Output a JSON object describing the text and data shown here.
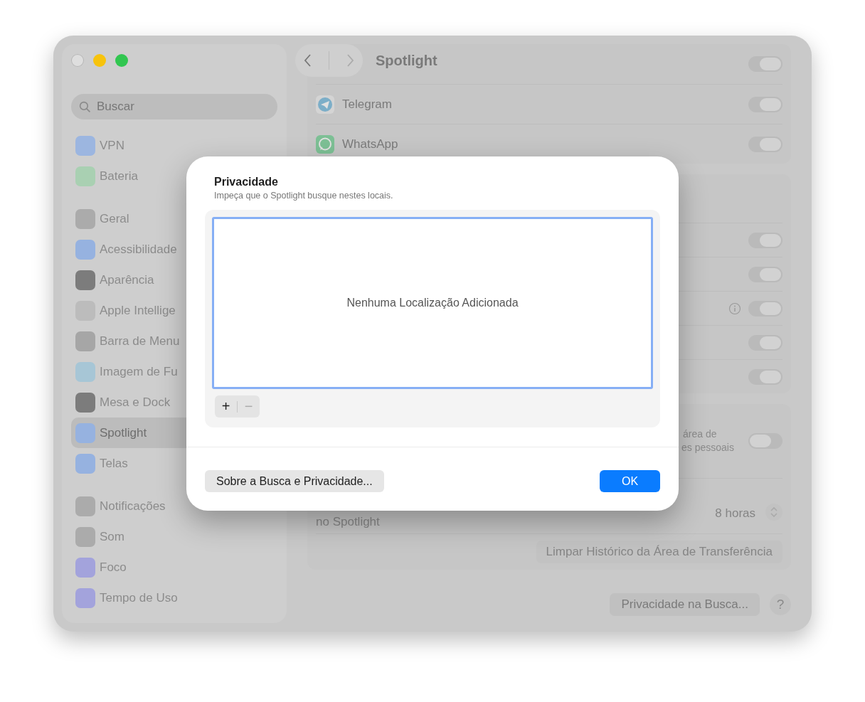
{
  "sidebar": {
    "search": {
      "placeholder": "Buscar"
    },
    "groups": [
      {
        "items": [
          {
            "label": "VPN",
            "selected": false,
            "color": "#9cb6e0"
          },
          {
            "label": "Bateria",
            "selected": false,
            "color": "#a9d0b2"
          }
        ]
      },
      {
        "items": [
          {
            "label": "Geral",
            "selected": false,
            "color": "#ababab"
          },
          {
            "label": "Acessibilidade",
            "selected": false,
            "color": "#96b2e0"
          },
          {
            "label": "Aparência",
            "selected": false,
            "color": "#7c7c7c"
          },
          {
            "label": "Apple Intellige",
            "selected": false,
            "color": "#bcbcbc"
          },
          {
            "label": "Barra de Menu",
            "selected": false,
            "color": "#a6a6a6"
          },
          {
            "label": "Imagem de Fu",
            "selected": false,
            "color": "#a7c6d6"
          },
          {
            "label": "Mesa e Dock",
            "selected": false,
            "color": "#7c7c7c"
          },
          {
            "label": "Spotlight",
            "selected": true,
            "color": "#96b2e0"
          },
          {
            "label": "Telas",
            "selected": false,
            "color": "#96b2e0"
          }
        ]
      },
      {
        "items": [
          {
            "label": "Notificações",
            "selected": false,
            "color": "#ababab"
          },
          {
            "label": "Som",
            "selected": false,
            "color": "#ababab"
          },
          {
            "label": "Foco",
            "selected": false,
            "color": "#a3a3dc"
          },
          {
            "label": "Tempo de Uso",
            "selected": false,
            "color": "#a3a3dc"
          }
        ]
      }
    ]
  },
  "content": {
    "title": "Spotlight",
    "apps": [
      {
        "kind": "blank",
        "on": true
      },
      {
        "kind": "telegram",
        "label": "Telegram",
        "on": true
      },
      {
        "kind": "whatsapp",
        "label": "WhatsApp",
        "on": true
      }
    ],
    "categories": [
      {
        "info": false,
        "on": true
      },
      {
        "info": false,
        "on": true
      },
      {
        "info": true,
        "on": true
      },
      {
        "info": false,
        "on": true
      },
      {
        "info": false,
        "on": true
      }
    ],
    "clipboard": {
      "lines": [
        "área de",
        "es pessoais"
      ],
      "on": false,
      "history_label": "no Spotlight",
      "history_value": "8 horas",
      "clear_button": "Limpar Histórico da Área de Transferência"
    },
    "privacy_button": "Privacidade na Busca...",
    "help": "?"
  },
  "dialog": {
    "title": "Privacidade",
    "subtitle": "Impeça que o Spotlight busque nestes locais.",
    "empty_text": "Nenhuma Localização Adicionada",
    "add": {
      "label": "+",
      "disabled": false
    },
    "remove": {
      "label": "−",
      "disabled": true
    },
    "about_button": "Sobre a Busca e Privacidade...",
    "ok_button": "OK"
  }
}
